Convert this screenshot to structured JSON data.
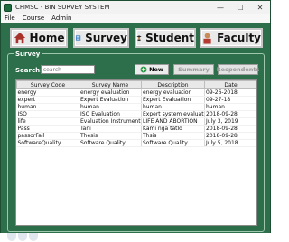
{
  "window": {
    "title": "CHMSC - BIN SURVEY SYSTEM",
    "controls": {
      "minimize": "—",
      "maximize": "☐",
      "close": "✕"
    }
  },
  "menu": [
    {
      "label": "File"
    },
    {
      "label": "Course"
    },
    {
      "label": "Admin"
    }
  ],
  "nav": {
    "home": "Home",
    "survey": "Survey",
    "student": "Student",
    "faculty": "Faculty"
  },
  "group": {
    "title": "Survey"
  },
  "search": {
    "label": "Search:",
    "placeholder": "search",
    "value": ""
  },
  "actions": {
    "new": "New",
    "summary": "Summary",
    "respondents": "Respondents"
  },
  "table": {
    "headers": [
      "Survey Code",
      "Survey Name",
      "Description",
      "Date"
    ],
    "rows": [
      [
        "energy",
        "energy evaluation",
        "energy evaluation",
        "09-26-2018"
      ],
      [
        "expert",
        "Expert Evaluation",
        "Expert Evaluation",
        "09-27-18"
      ],
      [
        "human",
        "human",
        "human",
        "human"
      ],
      [
        "ISO",
        "ISO Evaluation",
        "Expert system evaluation",
        "2018-09-28"
      ],
      [
        "life",
        "Evaluation Instrument",
        "LIFE AND ABORTION",
        "July 3, 2019"
      ],
      [
        "Pass",
        "Tani",
        "Kami nga tatlo",
        "2018-09-28"
      ],
      [
        "passorFail",
        "Thesis",
        "Thsis",
        "2018-09-28"
      ],
      [
        "SoftwareQuality",
        "Software Quality",
        "Software Quality",
        "July 5, 2018"
      ]
    ]
  },
  "colors": {
    "window_bg": "#2d6f4a",
    "accent_green": "#1d6c3e"
  }
}
